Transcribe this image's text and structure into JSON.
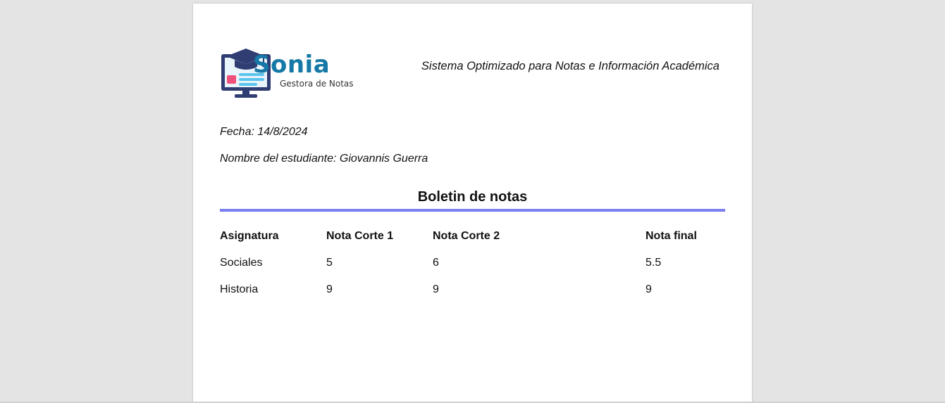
{
  "logo": {
    "name": "Sonia",
    "subtitle": "Gestora de Notas",
    "colors": {
      "primary": "#1578a6",
      "dark": "#2f3d73",
      "light": "#5bc4ee",
      "accent": "#f0517a"
    }
  },
  "header": {
    "tagline": "Sistema Optimizado para Notas e Información Académica"
  },
  "meta": {
    "fecha": "Fecha: 14/8/2024",
    "student": "Nombre del estudiante: Giovannis Guerra"
  },
  "report": {
    "title": "Boletin de notas",
    "rule_color": "#7b7ef2",
    "columns": [
      "Asignatura",
      "Nota Corte 1",
      "Nota Corte 2",
      "Nota final"
    ],
    "rows": [
      [
        "Sociales",
        "5",
        "6",
        "5.5"
      ],
      [
        "Historia",
        "9",
        "9",
        "9"
      ]
    ]
  }
}
